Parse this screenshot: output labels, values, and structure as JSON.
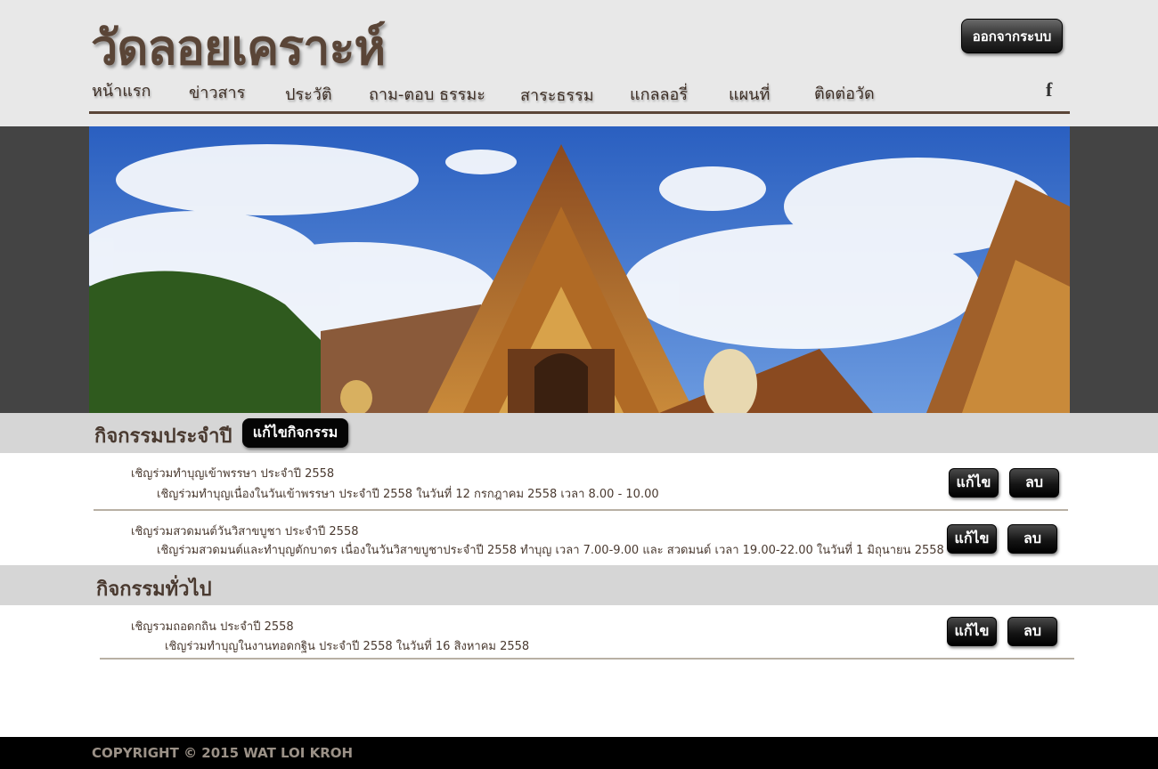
{
  "header": {
    "site_title": "วัดลอยเคราะห์",
    "logout_label": "ออกจากระบบ",
    "nav": [
      "หน้าแรก",
      "ข่าวสาร",
      "ประวัติ",
      "ถาม-ตอบ ธรรมะ",
      "สาระธรรม",
      "แกลลอรี่",
      "แผนที่",
      "ติดต่อวัด"
    ],
    "social_icon": "f"
  },
  "annual": {
    "title": "กิจกรรมประจำปี",
    "edit_label": "แก้ไขกิจกรรม",
    "items": [
      {
        "title": "เชิญร่วมทำบุญเข้าพรรษา ประจำปี 2558",
        "desc": "เชิญร่วมทำบุญเนื่องในวันเข้าพรรษา ประจำปี 2558 ในวันที่ 12 กรกฎาคม 2558 เวลา 8.00 - 10.00"
      },
      {
        "title": "เชิญร่วมสวดมนต์วันวิสาขบูชา ประจำปี 2558",
        "desc": "เชิญร่วมสวดมนต์และทำบุญตักบาตร เนื่องในวันวิสาขบูชาประจำปี 2558 ทำบุญ เวลา 7.00-9.00  และ สวดมนต์ เวลา 19.00-22.00 ในวันที่ 1 มิถุนายน 2558"
      }
    ]
  },
  "general": {
    "title": "กิจกรรมทั่วไป",
    "items": [
      {
        "title": "เชิญรวมถอดกถิน ประจำปี 2558",
        "desc": "เชิญร่วมทำบุญในงานทอดกฐิน ประจำปี 2558 ในวันที่ 16 สิงหาคม 2558"
      }
    ]
  },
  "buttons": {
    "edit": "แก้ไข",
    "delete": "ลบ"
  },
  "footer": {
    "copyright": "COPYRIGHT © 2015 WAT LOI KROH"
  }
}
